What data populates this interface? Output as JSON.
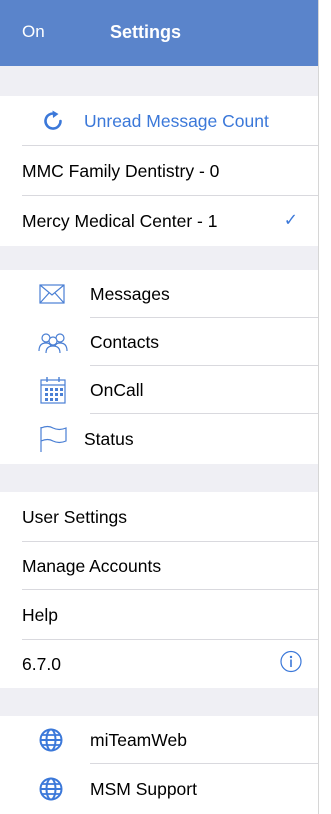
{
  "header": {
    "left_label": "On",
    "title": "Settings"
  },
  "unread": {
    "title": "Unread Message Count",
    "accounts": [
      {
        "label": "MMC Family Dentistry - 0",
        "checked": false
      },
      {
        "label": "Mercy Medical Center - 1",
        "checked": true
      }
    ]
  },
  "nav": {
    "items": [
      {
        "label": "Messages",
        "icon": "envelope-icon"
      },
      {
        "label": "Contacts",
        "icon": "contacts-icon"
      },
      {
        "label": "OnCall",
        "icon": "calendar-icon"
      },
      {
        "label": "Status",
        "icon": "flag-icon"
      }
    ]
  },
  "settings": {
    "items": [
      {
        "label": "User Settings"
      },
      {
        "label": "Manage Accounts"
      },
      {
        "label": "Help"
      },
      {
        "label": "6.7.0",
        "icon": "info-icon"
      }
    ]
  },
  "links": {
    "items": [
      {
        "label": "miTeamWeb",
        "icon": "globe-icon"
      },
      {
        "label": "MSM Support",
        "icon": "globe-icon"
      }
    ]
  },
  "colors": {
    "header_bg": "#5a84cb",
    "accent": "#3b78d9",
    "section_bg": "#efeff4"
  }
}
